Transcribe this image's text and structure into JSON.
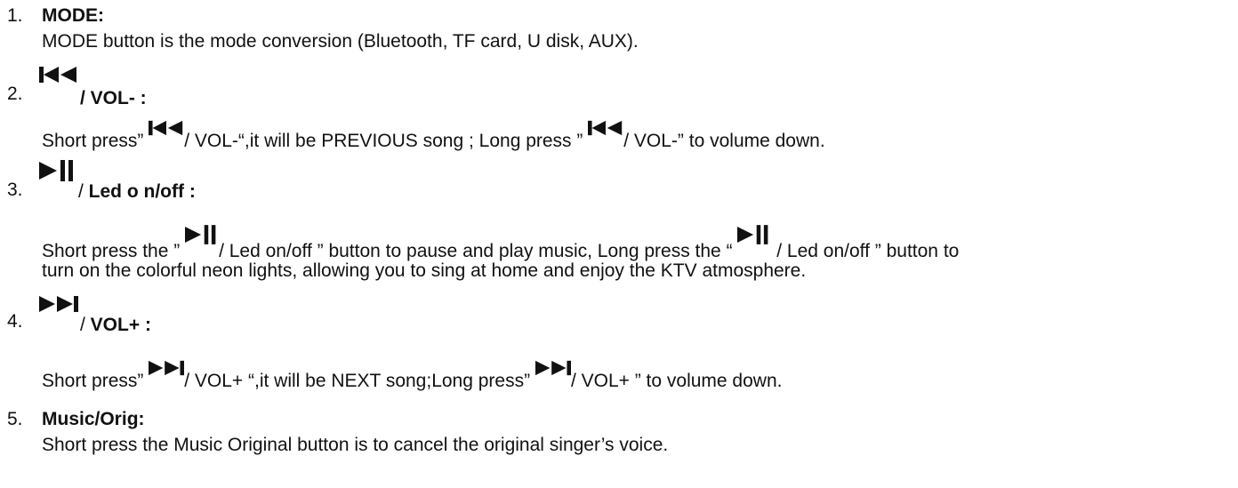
{
  "items": [
    {
      "number": "1.",
      "title": "MODE:",
      "description": "MODE button is the mode conversion (Bluetooth, TF card, U disk, AUX)."
    },
    {
      "number": "2.",
      "icon": "previous-track-icon",
      "title": "/ VOL- :",
      "desc_part1": "Short press” ",
      "desc_part2": "/ VOL-“,it will be PREVIOUS song ; Long press ” ",
      "desc_part3": "/ VOL-” to volume down."
    },
    {
      "number": "3.",
      "icon": "play-pause-icon",
      "title_slash": "/ ",
      "title": "Led o n/off :",
      "desc_part1": "Short press the ” ",
      "desc_part2": "/ Led on/off ” button to pause and play music, Long press the “ ",
      "desc_part3": " / Led on/off ” button to",
      "desc_line2": "turn on the colorful neon lights, allowing you to sing at home and enjoy the KTV atmosphere."
    },
    {
      "number": "4.",
      "icon": "next-track-icon",
      "title_slash": "/ ",
      "title": "VOL+ :",
      "desc_part1": "Short press” ",
      "desc_part2": "/ VOL+ “,it will be NEXT song;Long press” ",
      "desc_part3": "/ VOL+ ” to volume down."
    },
    {
      "number": "5.",
      "title": "Music/Orig:",
      "description": "Short press the Music Original button is to cancel the original singer’s voice."
    }
  ]
}
